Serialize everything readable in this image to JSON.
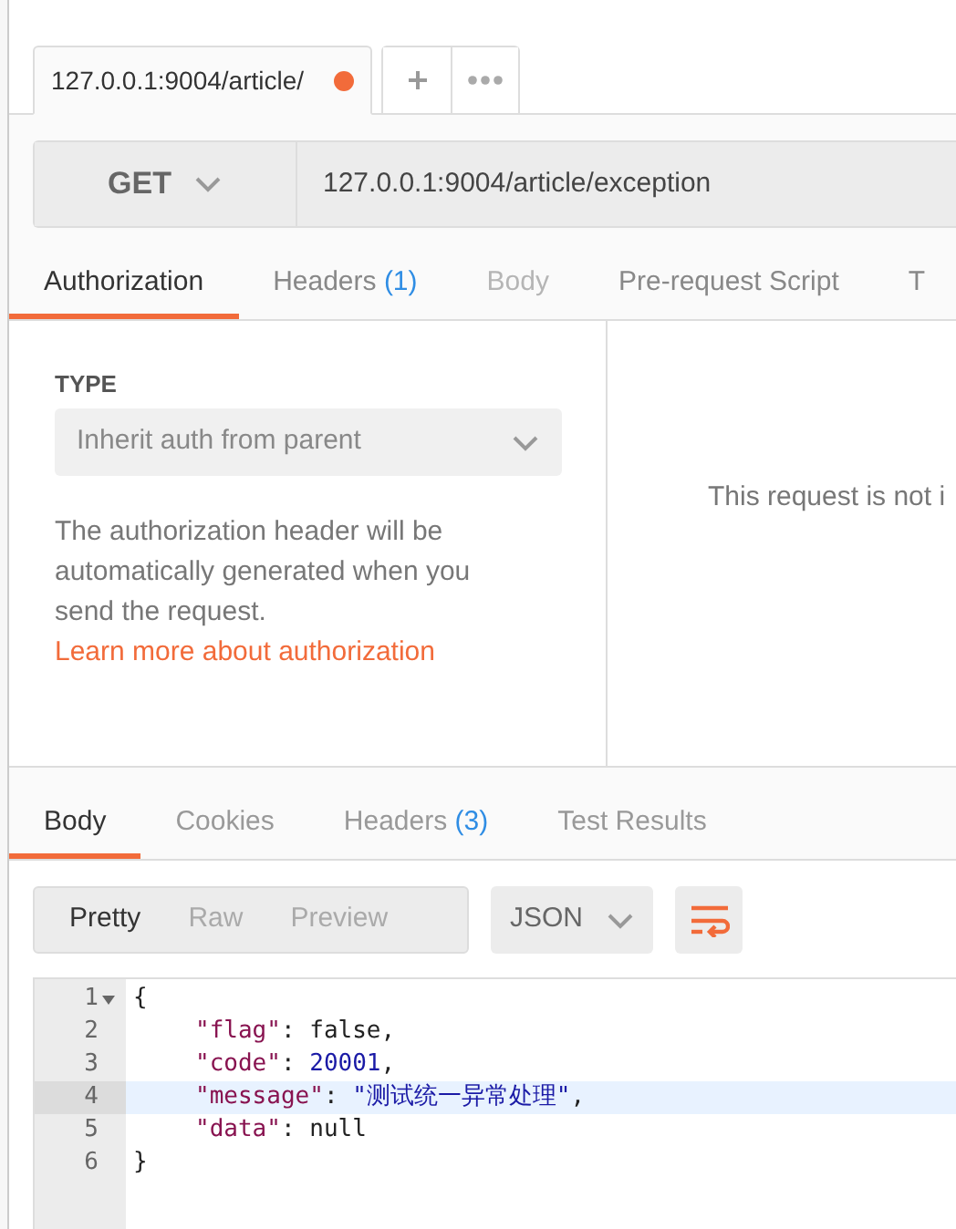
{
  "request_tabs": [
    {
      "label": "127.0.0.1:9004/article/",
      "selected": true,
      "unsaved": true
    }
  ],
  "tab_actions": [
    {
      "kind": "add"
    },
    {
      "kind": "more"
    }
  ],
  "request": {
    "method": "GET",
    "url": "127.0.0.1:9004/article/exception"
  },
  "request_sections": [
    {
      "label": "Authorization",
      "selected": true,
      "disabled": false
    },
    {
      "label": "Headers",
      "count": "(1)",
      "selected": false,
      "disabled": false
    },
    {
      "label": "Body",
      "selected": false,
      "disabled": true
    },
    {
      "label": "Pre-request Script",
      "selected": false,
      "disabled": false
    },
    {
      "label": "T",
      "selected": false,
      "disabled": false
    }
  ],
  "auth": {
    "type_label": "TYPE",
    "type_value": "Inherit auth from parent",
    "description": "The authorization header will be automatically generated when you send the request.",
    "link": "Learn more about authorization",
    "side_note": "This request is not i"
  },
  "response_tabs": [
    {
      "label": "Body",
      "selected": true
    },
    {
      "label": "Cookies",
      "selected": false
    },
    {
      "label": "Headers",
      "count": "(3)",
      "selected": false
    },
    {
      "label": "Test Results",
      "selected": false
    }
  ],
  "view_modes": [
    {
      "label": "Pretty",
      "selected": true
    },
    {
      "label": "Raw",
      "selected": false
    },
    {
      "label": "Preview",
      "selected": false
    }
  ],
  "format": "JSON",
  "wrap_on": true,
  "code": [
    {
      "number": "1",
      "foldable": true,
      "indented": false,
      "selected": false,
      "tokens": [
        {
          "kind": "punct",
          "text": "{"
        }
      ]
    },
    {
      "number": "2",
      "foldable": false,
      "indented": true,
      "selected": false,
      "tokens": [
        {
          "kind": "key",
          "text": "\"flag\""
        },
        {
          "kind": "punct",
          "text": ": "
        },
        {
          "kind": "atom",
          "text": "false"
        },
        {
          "kind": "punct",
          "text": ","
        }
      ]
    },
    {
      "number": "3",
      "foldable": false,
      "indented": true,
      "selected": false,
      "tokens": [
        {
          "kind": "key",
          "text": "\"code\""
        },
        {
          "kind": "punct",
          "text": ": "
        },
        {
          "kind": "number",
          "text": "20001"
        },
        {
          "kind": "punct",
          "text": ","
        }
      ]
    },
    {
      "number": "4",
      "foldable": false,
      "indented": true,
      "selected": true,
      "tokens": [
        {
          "kind": "key",
          "text": "\"message\""
        },
        {
          "kind": "punct",
          "text": ": "
        },
        {
          "kind": "string",
          "text": "\"测试统一异常处理\""
        },
        {
          "kind": "punct",
          "text": ","
        }
      ]
    },
    {
      "number": "5",
      "foldable": false,
      "indented": true,
      "selected": false,
      "tokens": [
        {
          "kind": "key",
          "text": "\"data\""
        },
        {
          "kind": "punct",
          "text": ": "
        },
        {
          "kind": "atom",
          "text": "null"
        }
      ]
    },
    {
      "number": "6",
      "foldable": false,
      "indented": false,
      "selected": false,
      "tokens": [
        {
          "kind": "punct",
          "text": "}"
        }
      ]
    }
  ]
}
